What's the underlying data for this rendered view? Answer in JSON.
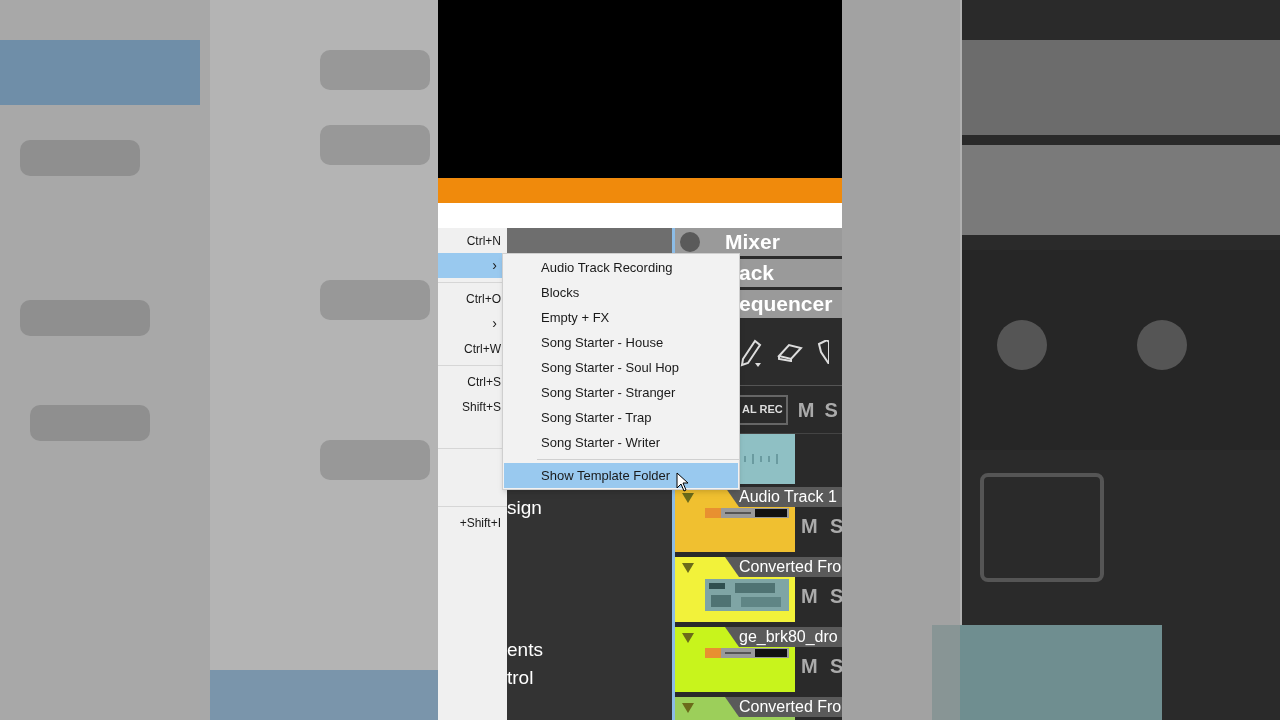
{
  "file_menu": {
    "items": [
      {
        "kind": "shortcut",
        "text": "Ctrl+N"
      },
      {
        "kind": "submenu",
        "arrow": "›",
        "selected": true
      },
      {
        "kind": "separator"
      },
      {
        "kind": "shortcut",
        "text": "Ctrl+O"
      },
      {
        "kind": "submenu",
        "arrow": "›",
        "selected": false
      },
      {
        "kind": "shortcut",
        "text": "Ctrl+W"
      },
      {
        "kind": "separator"
      },
      {
        "kind": "shortcut",
        "text": "Ctrl+S"
      },
      {
        "kind": "shortcut",
        "text": "Shift+S"
      },
      {
        "kind": "plain"
      },
      {
        "kind": "separator"
      },
      {
        "kind": "plain"
      },
      {
        "kind": "plain"
      },
      {
        "kind": "separator"
      },
      {
        "kind": "shortcut",
        "text": "+Shift+I"
      }
    ]
  },
  "template_submenu": {
    "items": [
      {
        "kind": "item",
        "label": "Audio Track Recording",
        "selected": false
      },
      {
        "kind": "item",
        "label": "Blocks",
        "selected": false
      },
      {
        "kind": "item",
        "label": "Empty + FX",
        "selected": false
      },
      {
        "kind": "item",
        "label": "Song Starter - House",
        "selected": false
      },
      {
        "kind": "item",
        "label": "Song Starter - Soul Hop",
        "selected": false
      },
      {
        "kind": "item",
        "label": "Song Starter - Stranger",
        "selected": false
      },
      {
        "kind": "item",
        "label": "Song Starter - Trap",
        "selected": false
      },
      {
        "kind": "item",
        "label": "Song Starter - Writer",
        "selected": false
      },
      {
        "kind": "separator"
      },
      {
        "kind": "item",
        "label": "Show Template Folder",
        "selected": true
      }
    ]
  },
  "browser_panel": {
    "texts": [
      "sign",
      "ents",
      "trol"
    ]
  },
  "view_tabs": [
    {
      "label": "Mixer",
      "dot": true
    },
    {
      "label": "ack",
      "dot": false
    },
    {
      "label": "equencer",
      "dot": false
    }
  ],
  "track_header": {
    "rec_button": "AL REC",
    "mute": "M",
    "solo": "S"
  },
  "tracks": [
    {
      "name": "Audio Track 1",
      "color": "#f0c030",
      "kind": "strip",
      "mute": "M",
      "solo": "S"
    },
    {
      "name": "Converted Fro",
      "color": "#f2f23a",
      "kind": "synth",
      "mute": "M",
      "solo": "S"
    },
    {
      "name": "ge_brk80_dro",
      "color": "#c8f41c",
      "kind": "strip",
      "mute": "M",
      "solo": "S"
    },
    {
      "name": "Converted Fro",
      "color": "#9ccf5a",
      "kind": "plain"
    }
  ]
}
